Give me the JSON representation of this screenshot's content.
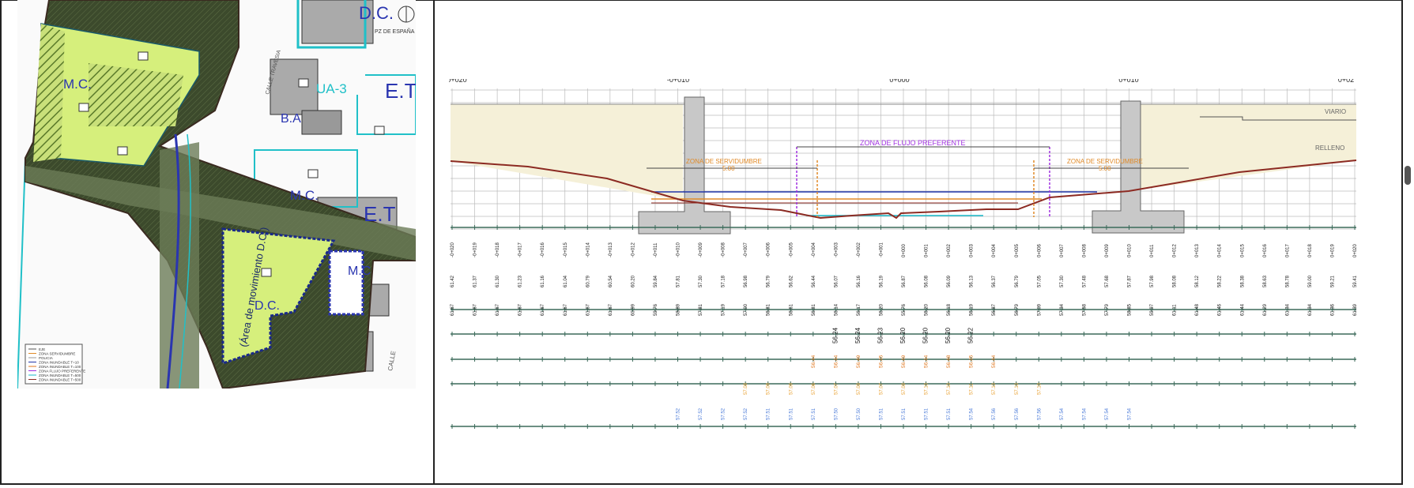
{
  "map": {
    "labels": {
      "dc_top": "D.C.",
      "plaza": "PZ DE ESPAÑA",
      "mc_left": "M.C.",
      "ua3": "UA-3",
      "et_top": "E.T",
      "ba": "B.A",
      "mc_mid": "M.C.",
      "et_mid": "E.T",
      "dc_bottom": "D.C.",
      "area_mov": "(Área de movimiento D.C.)",
      "mc_right": "M.C",
      "calle": "CALLE",
      "street_top": "CALLE TRAVESIA"
    },
    "legend": [
      "EJE",
      "ZONA SERVIDUMBRE",
      "POLICIA",
      "ZONA INUNDABLE T=10",
      "ZONA INUNDABLE T=100",
      "ZONA FLUJO PREFERENTE",
      "ZONA INUNDABLE T=500",
      "ZONA INUNDABLE T=500"
    ]
  },
  "section": {
    "chainage_top": [
      "0+020",
      "-0+010",
      "0+000",
      "0+010",
      "0+02"
    ],
    "labels": {
      "vial": "VIARIO",
      "relleno": "RELLENO",
      "flujo": "ZONA DE FLUJO PREFERENTE",
      "serv_left": "ZONA DE SERVIDUMBRE",
      "serv_left_val": "5.00",
      "serv_right": "ZONA DE SERVIDUMBRE",
      "serv_right_val": "5.00"
    },
    "stations": [
      "-0+020",
      "-0+019",
      "-0+018",
      "-0+017",
      "-0+016",
      "-0+015",
      "-0+014",
      "-0+013",
      "-0+012",
      "-0+011",
      "-0+010",
      "-0+009",
      "-0+008",
      "-0+007",
      "-0+006",
      "-0+005",
      "-0+004",
      "-0+003",
      "-0+002",
      "-0+001",
      "0+000",
      "0+001",
      "0+002",
      "0+003",
      "0+004",
      "0+005",
      "0+006",
      "0+007",
      "0+008",
      "0+009",
      "0+010",
      "0+011",
      "0+012",
      "0+013",
      "0+014",
      "0+015",
      "0+016",
      "0+017",
      "0+018",
      "0+019",
      "0+020"
    ],
    "row1": [
      "61.42",
      "61.37",
      "61.30",
      "61.23",
      "61.16",
      "61.04",
      "60.79",
      "60.54",
      "60.20",
      "59.84",
      "57.81",
      "57.30",
      "57.18",
      "56.98",
      "56.79",
      "56.62",
      "56.44",
      "56.07",
      "56.16",
      "56.19",
      "56.87",
      "56.08",
      "56.09",
      "56.13",
      "56.37",
      "56.79",
      "57.05",
      "57.30",
      "57.48",
      "57.68",
      "57.87",
      "57.98",
      "58.08",
      "58.12",
      "58.22",
      "58.38",
      "58.63",
      "58.78",
      "59.00",
      "59.21",
      "59.41"
    ],
    "row2": [
      "61.67",
      "61.67",
      "61.67",
      "61.67",
      "61.67",
      "61.67",
      "61.67",
      "61.67",
      "60.99",
      "59.76",
      "58.89",
      "57.81",
      "57.19",
      "57.00",
      "56.81",
      "56.61",
      "56.81",
      "56.14",
      "56.17",
      "56.20",
      "55.76",
      "56.20",
      "56.18",
      "56.19",
      "56.87",
      "56.79",
      "57.09",
      "57.34",
      "57.58",
      "57.79",
      "58.85",
      "59.97",
      "61.11",
      "61.48",
      "61.46",
      "61.44",
      "61.29",
      "61.34",
      "61.34",
      "61.36",
      "61.39"
    ],
    "row3": {
      "start": 17,
      "values": [
        "56.24",
        "56.24",
        "56.23",
        "56.20",
        "56.20",
        "56.20",
        "56.22"
      ]
    },
    "row4": {
      "start": 16,
      "values": [
        "56.44",
        "56.44",
        "56.49",
        "56.45",
        "56.49",
        "56.44",
        "56.48",
        "56.45",
        "56.44"
      ]
    },
    "row5": {
      "start": 13,
      "values": [
        "57.09",
        "57.09",
        "57.09",
        "57.06",
        "57.07",
        "57.09",
        "57.07",
        "57.09",
        "57.10",
        "57.10",
        "57.11",
        "57.10",
        "57.10",
        "57.10"
      ]
    },
    "row6": {
      "start": 10,
      "values": [
        "57.52",
        "57.52",
        "57.52",
        "57.52",
        "57.51",
        "57.51",
        "57.51",
        "57.50",
        "57.50",
        "57.51",
        "57.51",
        "57.51",
        "57.51",
        "57.54",
        "57.56",
        "57.56",
        "57.56",
        "57.54",
        "57.54",
        "57.54",
        "57.54"
      ]
    },
    "colors": {
      "row4": "#e0761c",
      "row5": "#e8a030",
      "row6": "#4a7ad8",
      "terrain": "#8c2a22",
      "fill": "#f5f0d8",
      "blue": "#2236a8",
      "cyan": "#18b8c8",
      "orange": "#e08a28",
      "purple": "#a030e0"
    }
  }
}
